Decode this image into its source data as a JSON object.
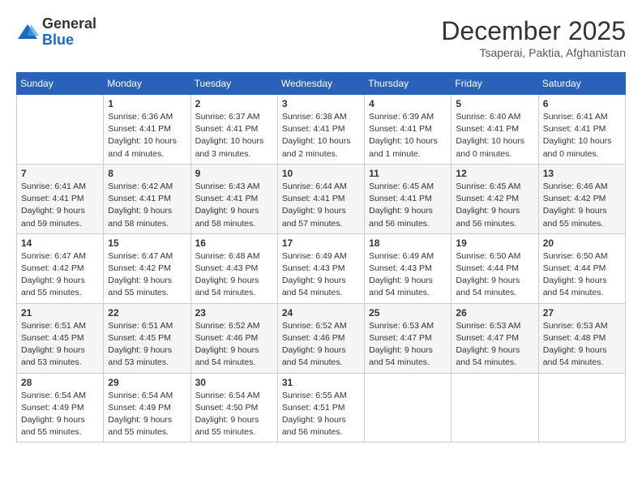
{
  "logo": {
    "general": "General",
    "blue": "Blue"
  },
  "header": {
    "month": "December 2025",
    "location": "Tsaperai, Paktia, Afghanistan"
  },
  "weekdays": [
    "Sunday",
    "Monday",
    "Tuesday",
    "Wednesday",
    "Thursday",
    "Friday",
    "Saturday"
  ],
  "weeks": [
    [
      {
        "day": "",
        "info": ""
      },
      {
        "day": "1",
        "info": "Sunrise: 6:36 AM\nSunset: 4:41 PM\nDaylight: 10 hours\nand 4 minutes."
      },
      {
        "day": "2",
        "info": "Sunrise: 6:37 AM\nSunset: 4:41 PM\nDaylight: 10 hours\nand 3 minutes."
      },
      {
        "day": "3",
        "info": "Sunrise: 6:38 AM\nSunset: 4:41 PM\nDaylight: 10 hours\nand 2 minutes."
      },
      {
        "day": "4",
        "info": "Sunrise: 6:39 AM\nSunset: 4:41 PM\nDaylight: 10 hours\nand 1 minute."
      },
      {
        "day": "5",
        "info": "Sunrise: 6:40 AM\nSunset: 4:41 PM\nDaylight: 10 hours\nand 0 minutes."
      },
      {
        "day": "6",
        "info": "Sunrise: 6:41 AM\nSunset: 4:41 PM\nDaylight: 10 hours\nand 0 minutes."
      }
    ],
    [
      {
        "day": "7",
        "info": "Sunrise: 6:41 AM\nSunset: 4:41 PM\nDaylight: 9 hours\nand 59 minutes."
      },
      {
        "day": "8",
        "info": "Sunrise: 6:42 AM\nSunset: 4:41 PM\nDaylight: 9 hours\nand 58 minutes."
      },
      {
        "day": "9",
        "info": "Sunrise: 6:43 AM\nSunset: 4:41 PM\nDaylight: 9 hours\nand 58 minutes."
      },
      {
        "day": "10",
        "info": "Sunrise: 6:44 AM\nSunset: 4:41 PM\nDaylight: 9 hours\nand 57 minutes."
      },
      {
        "day": "11",
        "info": "Sunrise: 6:45 AM\nSunset: 4:41 PM\nDaylight: 9 hours\nand 56 minutes."
      },
      {
        "day": "12",
        "info": "Sunrise: 6:45 AM\nSunset: 4:42 PM\nDaylight: 9 hours\nand 56 minutes."
      },
      {
        "day": "13",
        "info": "Sunrise: 6:46 AM\nSunset: 4:42 PM\nDaylight: 9 hours\nand 55 minutes."
      }
    ],
    [
      {
        "day": "14",
        "info": "Sunrise: 6:47 AM\nSunset: 4:42 PM\nDaylight: 9 hours\nand 55 minutes."
      },
      {
        "day": "15",
        "info": "Sunrise: 6:47 AM\nSunset: 4:42 PM\nDaylight: 9 hours\nand 55 minutes."
      },
      {
        "day": "16",
        "info": "Sunrise: 6:48 AM\nSunset: 4:43 PM\nDaylight: 9 hours\nand 54 minutes."
      },
      {
        "day": "17",
        "info": "Sunrise: 6:49 AM\nSunset: 4:43 PM\nDaylight: 9 hours\nand 54 minutes."
      },
      {
        "day": "18",
        "info": "Sunrise: 6:49 AM\nSunset: 4:43 PM\nDaylight: 9 hours\nand 54 minutes."
      },
      {
        "day": "19",
        "info": "Sunrise: 6:50 AM\nSunset: 4:44 PM\nDaylight: 9 hours\nand 54 minutes."
      },
      {
        "day": "20",
        "info": "Sunrise: 6:50 AM\nSunset: 4:44 PM\nDaylight: 9 hours\nand 54 minutes."
      }
    ],
    [
      {
        "day": "21",
        "info": "Sunrise: 6:51 AM\nSunset: 4:45 PM\nDaylight: 9 hours\nand 53 minutes."
      },
      {
        "day": "22",
        "info": "Sunrise: 6:51 AM\nSunset: 4:45 PM\nDaylight: 9 hours\nand 53 minutes."
      },
      {
        "day": "23",
        "info": "Sunrise: 6:52 AM\nSunset: 4:46 PM\nDaylight: 9 hours\nand 54 minutes."
      },
      {
        "day": "24",
        "info": "Sunrise: 6:52 AM\nSunset: 4:46 PM\nDaylight: 9 hours\nand 54 minutes."
      },
      {
        "day": "25",
        "info": "Sunrise: 6:53 AM\nSunset: 4:47 PM\nDaylight: 9 hours\nand 54 minutes."
      },
      {
        "day": "26",
        "info": "Sunrise: 6:53 AM\nSunset: 4:47 PM\nDaylight: 9 hours\nand 54 minutes."
      },
      {
        "day": "27",
        "info": "Sunrise: 6:53 AM\nSunset: 4:48 PM\nDaylight: 9 hours\nand 54 minutes."
      }
    ],
    [
      {
        "day": "28",
        "info": "Sunrise: 6:54 AM\nSunset: 4:49 PM\nDaylight: 9 hours\nand 55 minutes."
      },
      {
        "day": "29",
        "info": "Sunrise: 6:54 AM\nSunset: 4:49 PM\nDaylight: 9 hours\nand 55 minutes."
      },
      {
        "day": "30",
        "info": "Sunrise: 6:54 AM\nSunset: 4:50 PM\nDaylight: 9 hours\nand 55 minutes."
      },
      {
        "day": "31",
        "info": "Sunrise: 6:55 AM\nSunset: 4:51 PM\nDaylight: 9 hours\nand 56 minutes."
      },
      {
        "day": "",
        "info": ""
      },
      {
        "day": "",
        "info": ""
      },
      {
        "day": "",
        "info": ""
      }
    ]
  ]
}
